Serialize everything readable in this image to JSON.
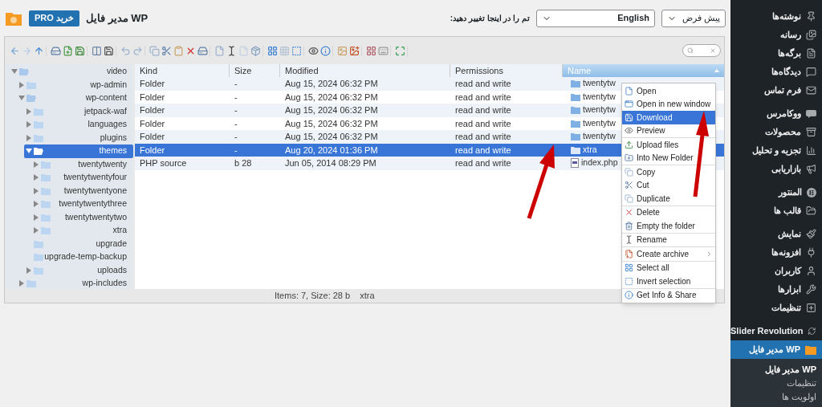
{
  "header": {
    "title": "WP مدیر فایل",
    "pro_button": "خرید PRO",
    "theme_label": "تم را در اینجا تغییر دهید:",
    "language_select": "English",
    "theme_select": "پیش فرض"
  },
  "tree": [
    {
      "label": "video",
      "has_children": true,
      "expanded": true,
      "selected": false,
      "children": [
        {
          "label": "wp-admin",
          "has_children": true,
          "expanded": false,
          "selected": false
        },
        {
          "label": "wp-content",
          "has_children": true,
          "expanded": true,
          "selected": false,
          "children": [
            {
              "label": "jetpack-waf",
              "has_children": true,
              "expanded": false,
              "selected": false
            },
            {
              "label": "languages",
              "has_children": true,
              "expanded": false,
              "selected": false
            },
            {
              "label": "plugins",
              "has_children": true,
              "expanded": false,
              "selected": false
            },
            {
              "label": "themes",
              "has_children": true,
              "expanded": true,
              "selected": true,
              "children": [
                {
                  "label": "twentytwenty",
                  "has_children": true,
                  "expanded": false,
                  "selected": false
                },
                {
                  "label": "twentytwentyfour",
                  "has_children": true,
                  "expanded": false,
                  "selected": false
                },
                {
                  "label": "twentytwentyone",
                  "has_children": true,
                  "expanded": false,
                  "selected": false
                },
                {
                  "label": "twentytwentythree",
                  "has_children": true,
                  "expanded": false,
                  "selected": false
                },
                {
                  "label": "twentytwentytwo",
                  "has_children": true,
                  "expanded": false,
                  "selected": false
                },
                {
                  "label": "xtra",
                  "has_children": true,
                  "expanded": false,
                  "selected": false
                }
              ]
            },
            {
              "label": "upgrade",
              "has_children": false,
              "selected": false
            },
            {
              "label": "upgrade-temp-backup",
              "has_children": false,
              "selected": false
            },
            {
              "label": "uploads",
              "has_children": true,
              "expanded": false,
              "selected": false
            }
          ]
        },
        {
          "label": "wp-includes",
          "has_children": true,
          "expanded": false,
          "selected": false
        }
      ]
    }
  ],
  "table": {
    "columns": [
      {
        "label": "Kind",
        "sorted": false
      },
      {
        "label": "Size",
        "sorted": false
      },
      {
        "label": "Modified",
        "sorted": false
      },
      {
        "label": "Permissions",
        "sorted": false
      },
      {
        "label": "Name",
        "sorted": true
      }
    ],
    "rows": [
      {
        "cells": [
          "Folder",
          "-",
          "Aug 15, 2024 06:32 PM",
          "read and write"
        ],
        "name": "twentytw",
        "kind": "folder",
        "selected": false
      },
      {
        "cells": [
          "Folder",
          "-",
          "Aug 15, 2024 06:32 PM",
          "read and write"
        ],
        "name": "twentytw",
        "kind": "folder",
        "selected": false
      },
      {
        "cells": [
          "Folder",
          "-",
          "Aug 15, 2024 06:32 PM",
          "read and write"
        ],
        "name": "twentytw",
        "kind": "folder",
        "selected": false
      },
      {
        "cells": [
          "Folder",
          "-",
          "Aug 15, 2024 06:32 PM",
          "read and write"
        ],
        "name": "twentytw",
        "kind": "folder",
        "selected": false
      },
      {
        "cells": [
          "Folder",
          "-",
          "Aug 15, 2024 06:32 PM",
          "read and write"
        ],
        "name": "twentytw",
        "kind": "folder",
        "selected": false
      },
      {
        "cells": [
          "Folder",
          "-",
          "Aug 20, 2024 01:36 PM",
          "read and write"
        ],
        "name": "xtra",
        "kind": "folder",
        "selected": true
      },
      {
        "cells": [
          "PHP source",
          "b 28",
          "Jun 05, 2014 08:29 PM",
          "read and write"
        ],
        "name": "index.php",
        "kind": "file",
        "selected": false
      }
    ]
  },
  "status_bar": {
    "summary": "Items: 7, Size: 28 b",
    "current": "xtra"
  },
  "context_menu": {
    "groups": [
      [
        {
          "label": "Open",
          "selected": false,
          "submenu": false
        },
        {
          "label": "Open in new window",
          "selected": false,
          "submenu": false
        },
        {
          "label": "Download",
          "selected": true,
          "submenu": false
        },
        {
          "label": "Preview",
          "selected": false,
          "submenu": false
        }
      ],
      [
        {
          "label": "Upload files",
          "selected": false,
          "submenu": false
        },
        {
          "label": "Into New Folder",
          "selected": false,
          "submenu": false
        }
      ],
      [
        {
          "label": "Copy",
          "selected": false,
          "submenu": false
        },
        {
          "label": "Cut",
          "selected": false,
          "submenu": false
        },
        {
          "label": "Duplicate",
          "selected": false,
          "submenu": false
        }
      ],
      [
        {
          "label": "Delete",
          "selected": false,
          "submenu": false
        },
        {
          "label": "Empty the folder",
          "selected": false,
          "submenu": false
        }
      ],
      [
        {
          "label": "Rename",
          "selected": false,
          "submenu": false
        }
      ],
      [
        {
          "label": "Create archive",
          "selected": false,
          "submenu": true
        }
      ],
      [
        {
          "label": "Select all",
          "selected": false,
          "submenu": false
        },
        {
          "label": "Invert selection",
          "selected": false,
          "submenu": false
        }
      ],
      [
        {
          "label": "Get Info & Share",
          "selected": false,
          "submenu": false
        }
      ]
    ]
  },
  "sidebar": {
    "groups": [
      [
        {
          "label": "نوشته‌ها",
          "selected": false
        },
        {
          "label": "رسانه",
          "selected": false
        },
        {
          "label": "برگه‌ها",
          "selected": false
        },
        {
          "label": "دیدگاه‌ها",
          "selected": false
        },
        {
          "label": "فرم تماس",
          "selected": false
        }
      ],
      [
        {
          "label": "ووکامرس",
          "selected": false
        },
        {
          "label": "محصولات",
          "selected": false
        },
        {
          "label": "تجزیه و تحلیل",
          "selected": false
        },
        {
          "label": "بازاریابی",
          "selected": false
        }
      ],
      [
        {
          "label": "المنتور",
          "selected": false
        },
        {
          "label": "قالب ها",
          "selected": false
        }
      ],
      [
        {
          "label": "نمایش",
          "selected": false
        },
        {
          "label": "افزونه‌ها",
          "selected": false
        },
        {
          "label": "کاربران",
          "selected": false
        },
        {
          "label": "ابزارها",
          "selected": false
        },
        {
          "label": "تنظیمات",
          "selected": false
        }
      ],
      [
        {
          "label": "Slider Revolution",
          "selected": false
        },
        {
          "label": "WP مدیر فایل",
          "selected": true
        }
      ]
    ],
    "submenu": [
      {
        "label": "WP مدیر فایل",
        "selected": true
      },
      {
        "label": "تنظیمات",
        "selected": false
      },
      {
        "label": "اولویت ها",
        "selected": false
      }
    ]
  }
}
